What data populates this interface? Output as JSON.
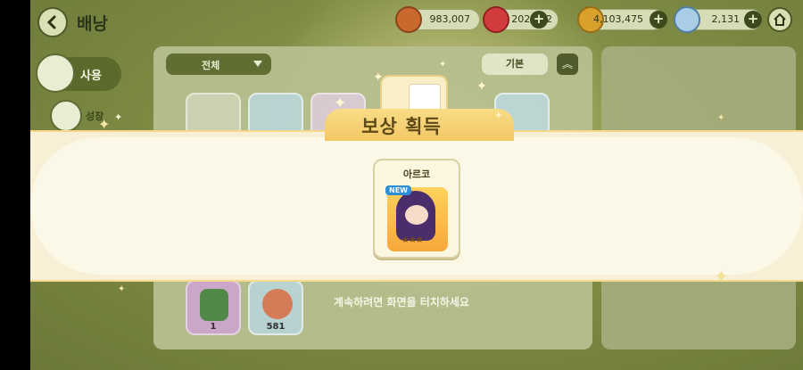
{
  "header": {
    "title": "배낭",
    "currencies": [
      {
        "name": "coin-a",
        "value": "983,007",
        "color": "#c9692e"
      },
      {
        "name": "energy",
        "value": "202/202",
        "color": "#d23c3c"
      },
      {
        "name": "gold",
        "value": "4,103,475",
        "color": "#d9a12b"
      },
      {
        "name": "butterfly",
        "value": "2,131",
        "color": "#6fa3c8"
      }
    ]
  },
  "sidebar": {
    "items": [
      {
        "label": "사용"
      },
      {
        "label": "성장"
      }
    ]
  },
  "inventory": {
    "filter_label": "전체",
    "sort_label": "기본",
    "bottom_counts": [
      "1",
      "581"
    ]
  },
  "reward": {
    "title": "보상 획득",
    "item_name": "아르코",
    "badge": "NEW",
    "continue_hint": "계속하려면 화면을 터치하세요"
  },
  "colors": {
    "accent_green": "#5f6d34",
    "banner_cream": "#fcf8e8",
    "ribbon_gold": "#f2c765"
  }
}
